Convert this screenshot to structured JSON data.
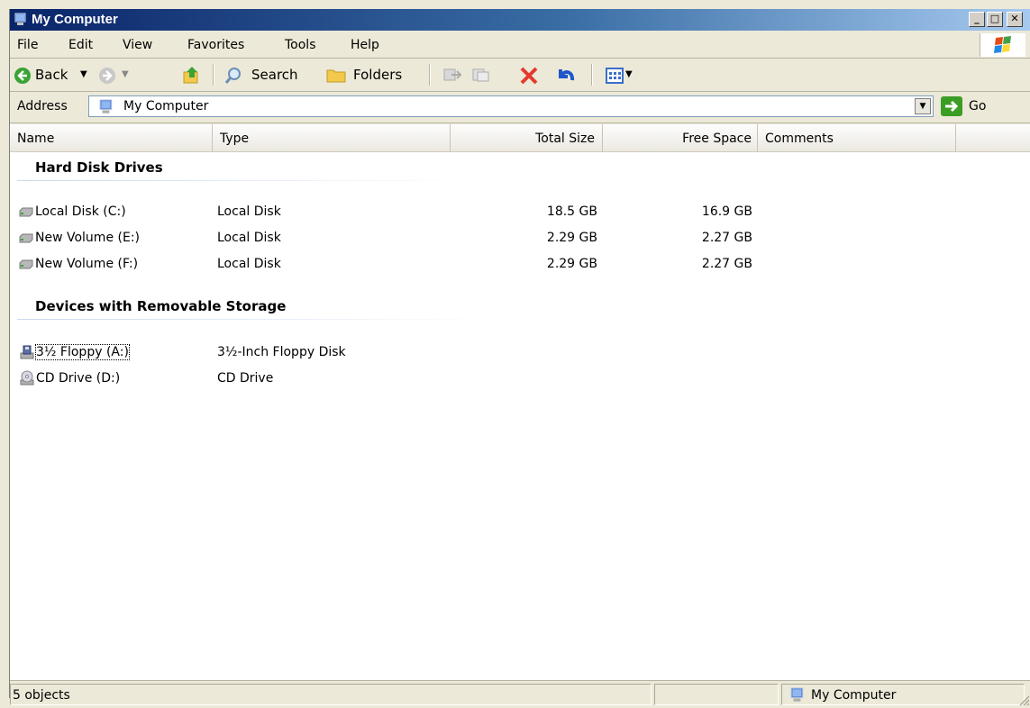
{
  "window": {
    "title": "My Computer"
  },
  "menu": [
    "File",
    "Edit",
    "View",
    "Favorites",
    "Tools",
    "Help"
  ],
  "toolbar": {
    "back": "Back",
    "search": "Search",
    "folders": "Folders"
  },
  "address": {
    "label": "Address",
    "value": "My Computer",
    "go": "Go"
  },
  "columns": [
    "Name",
    "Type",
    "Total Size",
    "Free Space",
    "Comments"
  ],
  "groups": [
    {
      "title": "Hard Disk Drives",
      "items": [
        {
          "name": "Local Disk (C:)",
          "type": "Local Disk",
          "total": "18.5 GB",
          "free": "16.9 GB"
        },
        {
          "name": "New Volume (E:)",
          "type": "Local Disk",
          "total": "2.29 GB",
          "free": "2.27 GB"
        },
        {
          "name": "New Volume (F:)",
          "type": "Local Disk",
          "total": "2.29 GB",
          "free": "2.27 GB"
        }
      ]
    },
    {
      "title": "Devices with Removable Storage",
      "items": [
        {
          "name": "3½ Floppy (A:)",
          "type": "3½-Inch Floppy Disk",
          "total": "",
          "free": ""
        },
        {
          "name": "CD Drive (D:)",
          "type": "CD Drive",
          "total": "",
          "free": ""
        }
      ]
    }
  ],
  "status": {
    "objects": "5 objects",
    "location": "My Computer"
  },
  "icons": {
    "title": "my-computer-icon",
    "back": "back-arrow-icon",
    "forward": "forward-arrow-icon",
    "up": "up-folder-icon",
    "search": "search-icon",
    "folders": "folders-icon",
    "hard_disk": "hard-disk-icon",
    "floppy": "floppy-drive-icon",
    "cd": "cd-drive-icon"
  }
}
